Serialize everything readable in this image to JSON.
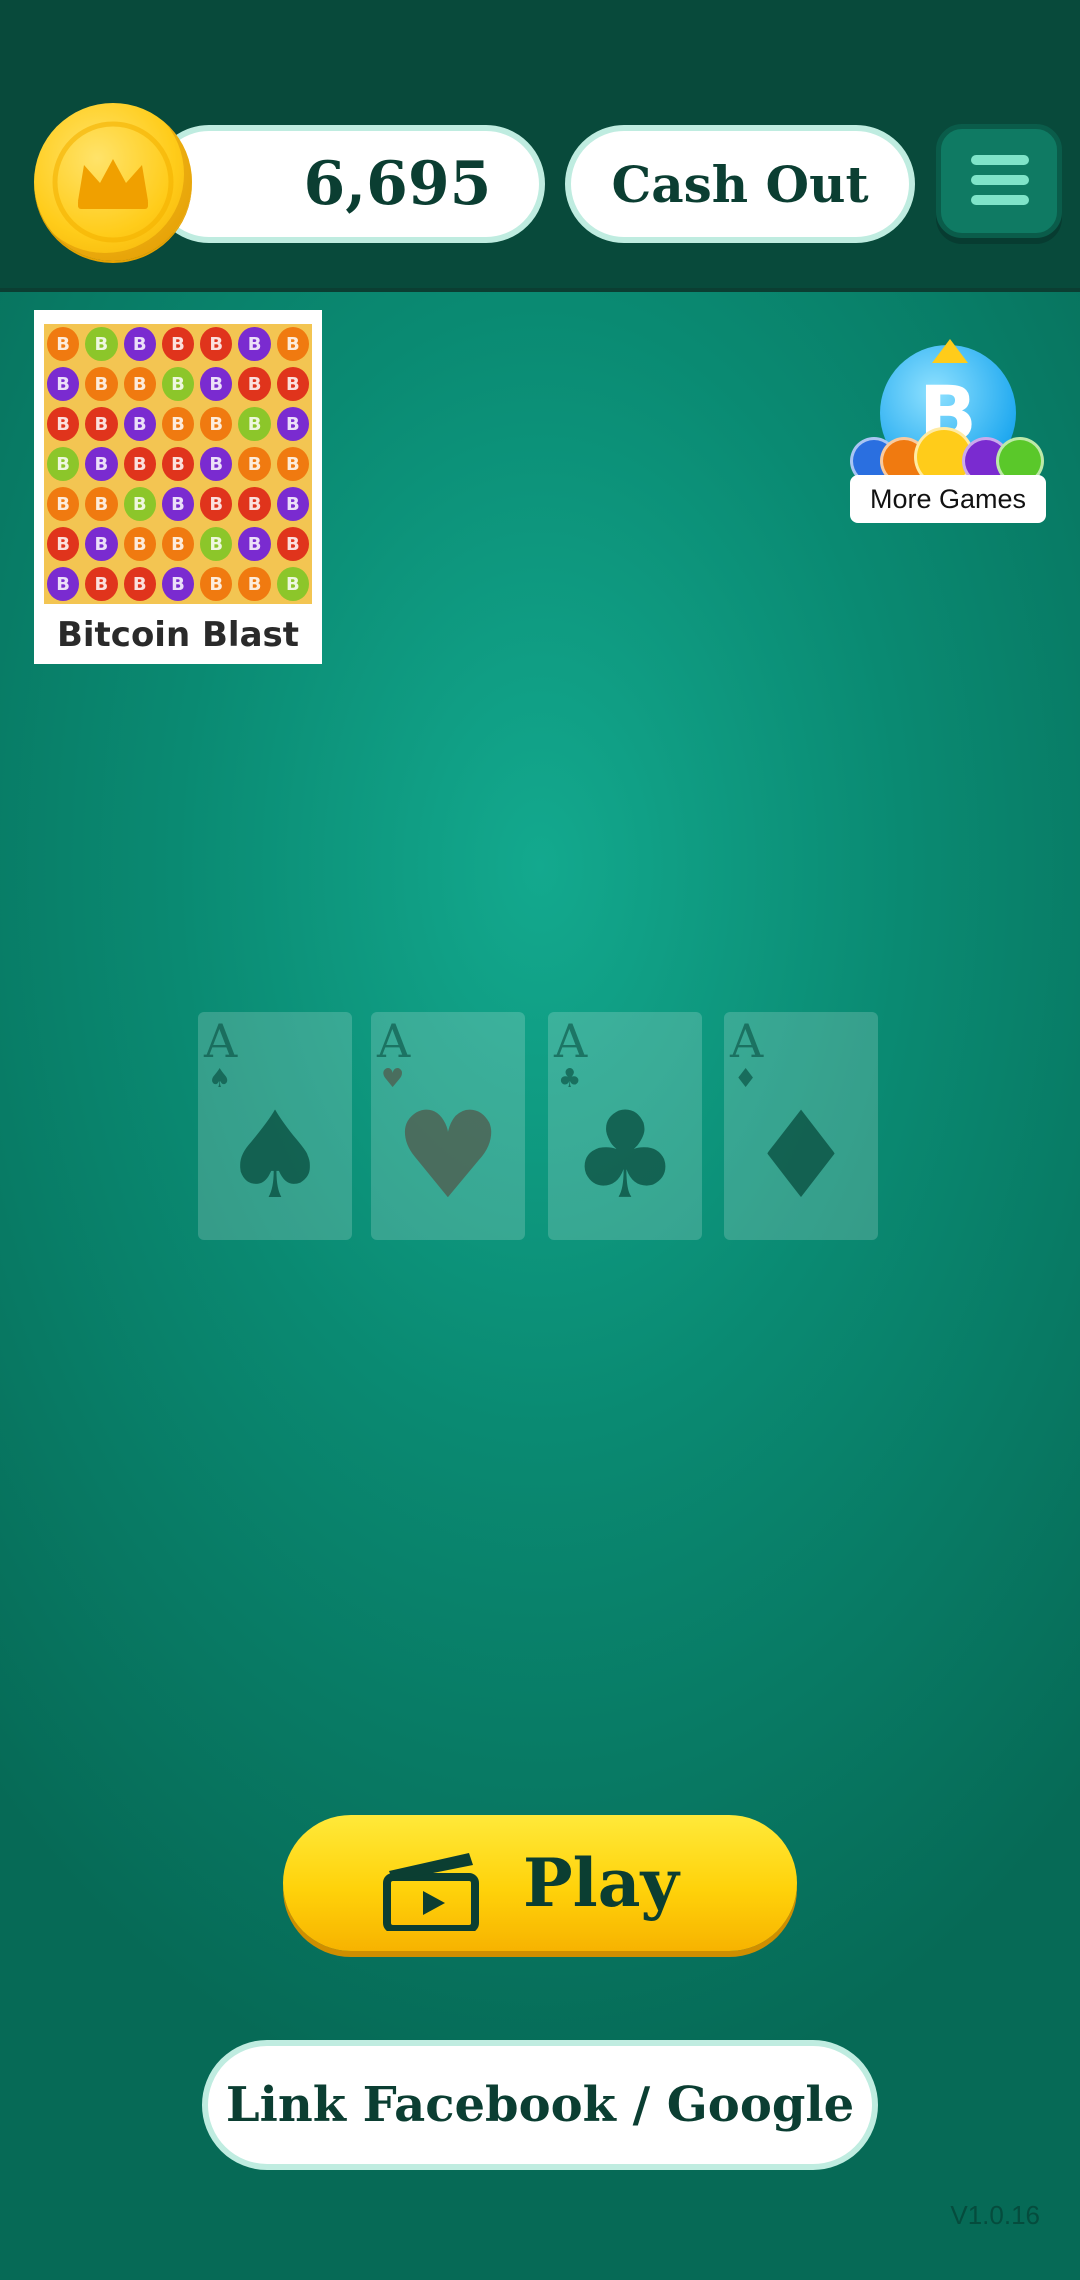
{
  "header": {
    "balance": "6,695",
    "coin_icon": "crown-coin-icon",
    "cashout_label": "Cash Out",
    "menu_icon": "hamburger-menu-icon"
  },
  "featured_game": {
    "title": "Bitcoin Blast"
  },
  "more_games": {
    "label": "More Games",
    "icon": "bitcoin-games-icon"
  },
  "cards": [
    {
      "rank": "A",
      "suit": "♠",
      "suit_name": "spades"
    },
    {
      "rank": "A",
      "suit": "♥",
      "suit_name": "hearts"
    },
    {
      "rank": "A",
      "suit": "♣",
      "suit_name": "clubs"
    },
    {
      "rank": "A",
      "suit": "♦",
      "suit_name": "diamonds"
    }
  ],
  "play": {
    "label": "Play",
    "icon": "clapperboard-play-icon"
  },
  "link_account": {
    "label": "Link Facebook / Google"
  },
  "version": "V1.0.16",
  "colors": {
    "header_bg": "#084a3b",
    "felt": "#0a8a72",
    "accent_yellow": "#ffd20a",
    "text_dark": "#0b3e32"
  }
}
